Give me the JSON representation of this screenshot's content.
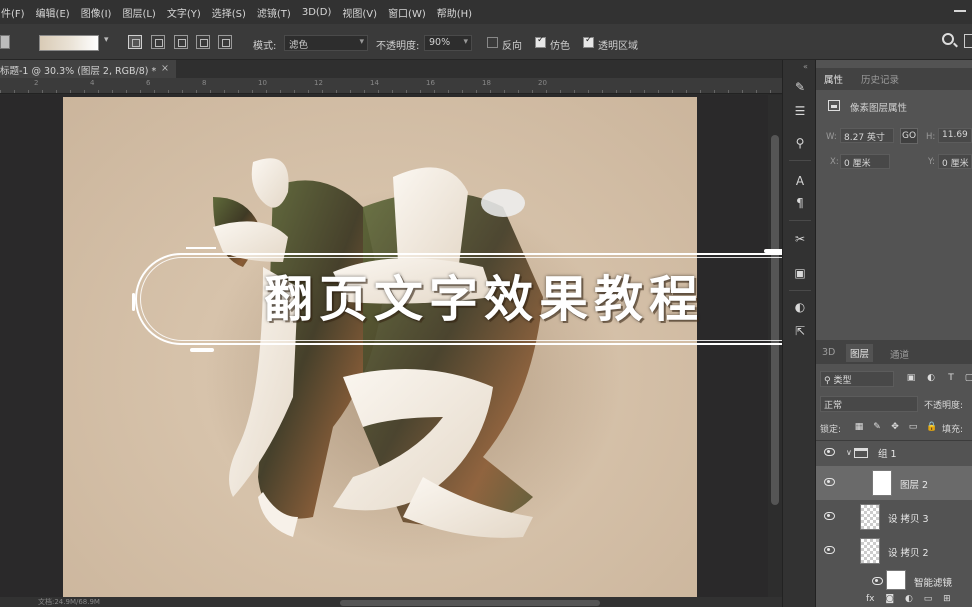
{
  "menu": [
    "件(F)",
    "编辑(E)",
    "图像(I)",
    "图层(L)",
    "文字(Y)",
    "选择(S)",
    "滤镜(T)",
    "3D(D)",
    "视图(V)",
    "窗口(W)",
    "帮助(H)"
  ],
  "options": {
    "mode_label": "模式:",
    "mode_value": "滤色",
    "opacity_label": "不透明度:",
    "opacity_value": "90%",
    "reverse_label": "反向",
    "dither_label": "仿色",
    "transparency_label": "透明区域",
    "reverse_checked": false,
    "dither_checked": true,
    "transparency_checked": true
  },
  "document": {
    "tab_title": "标题-1 @ 30.3% (图层 2, RGB/8) *",
    "close": "×",
    "status": "文档:24.9M/68.9M",
    "ruler_marks": [
      "2",
      "4",
      "6",
      "8",
      "10",
      "12",
      "14",
      "16",
      "18",
      "20"
    ]
  },
  "artwork": {
    "title": "翻页文字效果教程",
    "colors": {
      "background": "#d7c3ab",
      "paper": "#f3ece3",
      "texture_dark": "#3f3a25",
      "texture_green": "#5f6a3a",
      "texture_warm": "#8a5b35"
    }
  },
  "properties": {
    "tabs": [
      "属性",
      "历史记录"
    ],
    "active_tab": 0,
    "section": "像素图层属性",
    "w_label": "W:",
    "w_value": "8.27 英寸",
    "link": "GO",
    "h_label": "H:",
    "h_value": "11.69",
    "x_label": "X:",
    "x_value": "0 厘米",
    "y_label": "Y:",
    "y_value": "0 厘米"
  },
  "layers_panel": {
    "tabs": [
      "3D",
      "图层",
      "通道"
    ],
    "active_tab": 1,
    "filter_value": "类型",
    "blend_mode": "正常",
    "opacity_label": "不透明度:",
    "lock_label": "锁定:",
    "fill_label": "填充:",
    "layers": [
      {
        "name": "组 1",
        "type": "group"
      },
      {
        "name": "图层 2",
        "type": "pixel",
        "selected": true
      },
      {
        "name": "设 拷贝 3",
        "type": "smart"
      },
      {
        "name": "设 拷贝 2",
        "type": "smart"
      },
      {
        "name": "智能滤镜",
        "type": "filter"
      }
    ],
    "bottom_icons": [
      "fx",
      "mask-icon",
      "adjustment-icon",
      "folder-icon",
      "new-layer-icon"
    ]
  },
  "tools": [
    "brush-icon",
    "sliders-icon",
    "clone-stamp-icon",
    "type-icon",
    "paragraph-icon",
    "crosshair-icon",
    "properties-icon",
    "paint-bucket-icon",
    "export-icon"
  ]
}
